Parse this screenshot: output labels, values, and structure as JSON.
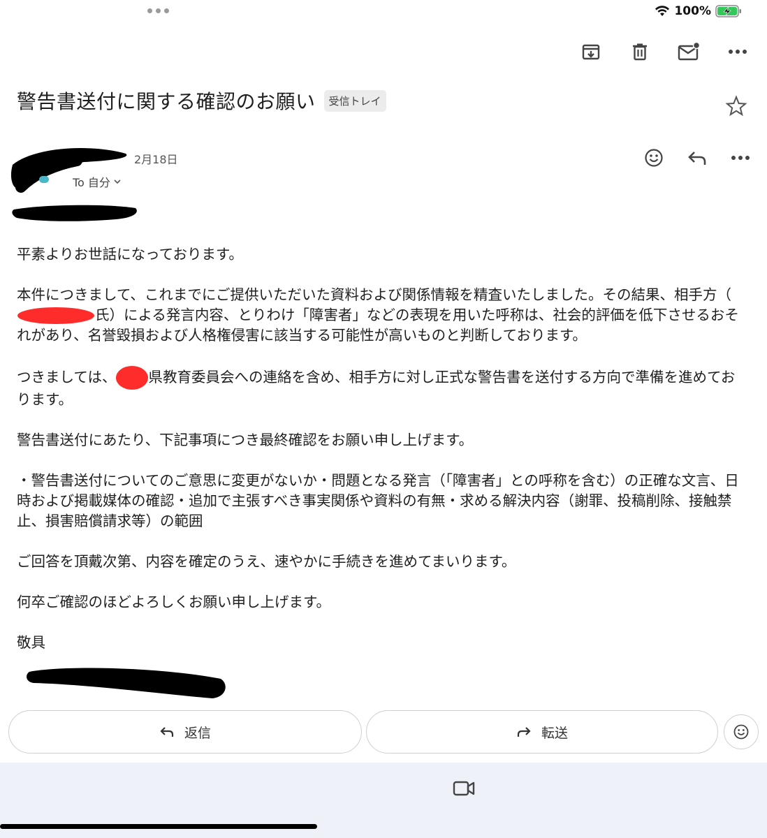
{
  "status_bar": {
    "battery": "100%"
  },
  "email": {
    "subject": "警告書送付に関する確認のお願い",
    "label": "受信トレイ",
    "date": "2月18日",
    "to": "To 自分",
    "greeting": "平素よりお世話になっております。",
    "p1_a": "本件につきまして、これまでにご提供いただいた資料および関係情報を精査いたしました。その結果、相手方（",
    "p1_b": "氏）による発言内容、とりわけ「障害者」などの表現を用いた呼称は、社会的評価を低下させるおそれがあり、名誉毀損および人格権侵害に該当する可能性が高いものと判断しております。",
    "p2_a": "つきましては、",
    "p2_b": "県教育委員会への連絡を含め、相手方に対し正式な警告書を送付する方向で準備を進めております。",
    "p3": "警告書送付にあたり、下記事項につき最終確認をお願い申し上げます。",
    "p4": "・警告書送付についてのご意思に変更がないか・問題となる発言（「障害者」との呼称を含む）の正確な文言、日時および掲載媒体の確認・追加で主張すべき事実関係や資料の有無・求める解決内容（謝罪、投稿削除、接触禁止、損害賠償請求等）の範囲",
    "p5": "ご回答を頂戴次第、内容を確定のうえ、速やかに手続きを進めてまいります。",
    "p6": "何卒ご確認のほどよろしくお願い申し上げます。",
    "closing": "敬具"
  },
  "actions": {
    "reply": "返信",
    "forward": "転送"
  },
  "icons": {
    "archive": "archive-icon",
    "delete": "trash-icon",
    "mark_unread": "mail-unread-icon",
    "more": "more-icon",
    "star": "star-icon",
    "emoji": "emoji-icon",
    "reply": "reply-icon",
    "forward": "forward-icon",
    "video": "video-icon"
  }
}
